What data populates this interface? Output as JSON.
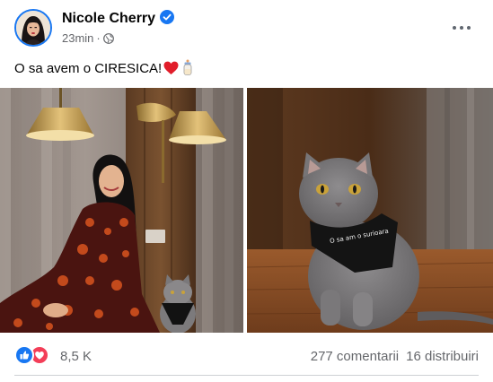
{
  "post": {
    "author": "Nicole Cherry",
    "timestamp": "23min",
    "separator": "·",
    "privacy_icon": "globe-icon",
    "verified_icon": "verified-badge-icon",
    "more_icon": "more-options-icon",
    "caption": "O sa avem o CIRESICA!",
    "caption_emojis": [
      "red-heart-emoji",
      "baby-bottle-emoji"
    ]
  },
  "photos": [
    {
      "name": "photo-woman-with-cat",
      "description_icon": "photo"
    },
    {
      "name": "photo-cat-with-bandana",
      "description_icon": "photo"
    }
  ],
  "bandana_text": "O sa am o surioara",
  "footer": {
    "reaction_icons": [
      "like-icon",
      "love-icon"
    ],
    "reactions_count": "8,5 K",
    "comments": "277 comentarii",
    "shares": "16 distribuiri"
  },
  "colors": {
    "accent": "#1877f2",
    "love": "#f33e58",
    "secondary_text": "#65676b"
  }
}
